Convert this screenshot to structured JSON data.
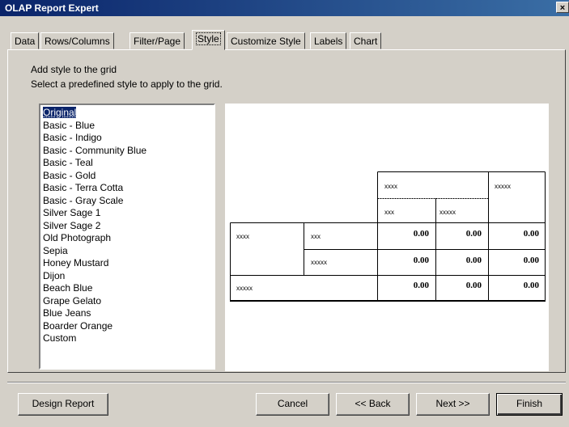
{
  "window": {
    "title": "OLAP Report Expert",
    "close_label": "×"
  },
  "tabs": [
    {
      "label": "Data"
    },
    {
      "label": "Rows/Columns"
    },
    {
      "label": "Filter/Page"
    },
    {
      "label": "Style",
      "active": true
    },
    {
      "label": "Customize Style"
    },
    {
      "label": "Labels"
    },
    {
      "label": "Chart"
    }
  ],
  "page": {
    "heading": "Add style to the grid",
    "instruction": "Select a predefined style to apply to the grid."
  },
  "styles": {
    "selected": "Original",
    "items": [
      "Original",
      "Basic - Blue",
      "Basic - Indigo",
      "Basic - Community Blue",
      "Basic - Teal",
      "Basic - Gold",
      "Basic - Terra Cotta",
      "Basic - Gray Scale",
      "Silver Sage 1",
      "Silver Sage 2",
      "Old Photograph",
      "Sepia",
      "Honey Mustard",
      "Dijon",
      "Beach Blue",
      "Grape Gelato",
      "Blue Jeans",
      "Boarder Orange",
      "Custom"
    ]
  },
  "preview": {
    "col_header_1": "xxxx",
    "col_header_2": "xxxxx",
    "sub_header_1": "xxx",
    "sub_header_2": "xxxxx",
    "row_header_1": "xxxx",
    "row_sub_1": "xxx",
    "row_sub_2": "xxxxx",
    "row_total": "xxxxx",
    "values": [
      "0.00",
      "0.00",
      "0.00",
      "0.00",
      "0.00",
      "0.00",
      "0.00",
      "0.00",
      "0.00"
    ]
  },
  "buttons": {
    "design_report": "Design Report",
    "cancel": "Cancel",
    "back": "<< Back",
    "next": "Next >>",
    "finish": "Finish"
  }
}
